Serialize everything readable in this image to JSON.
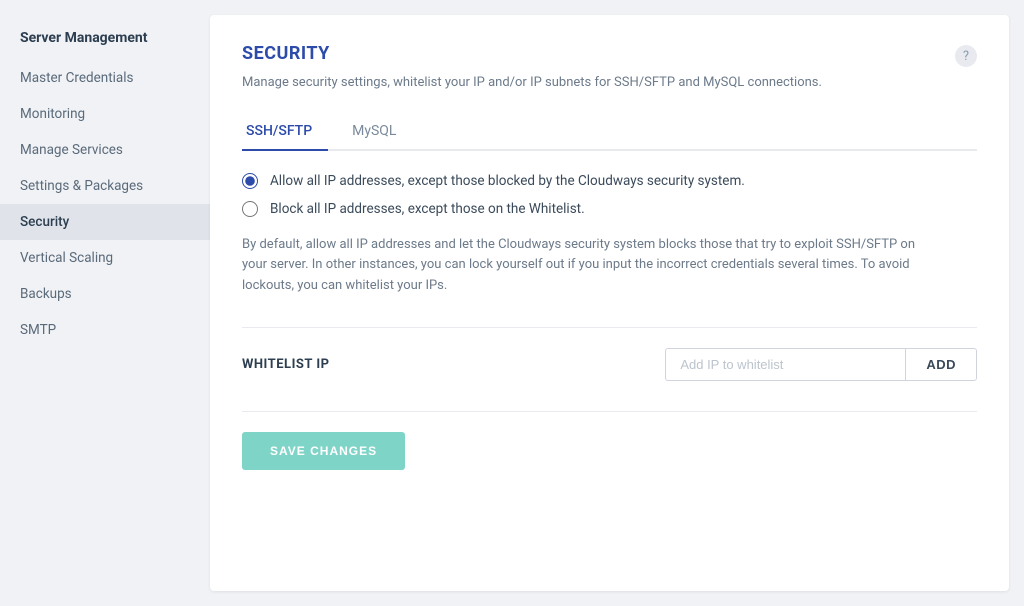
{
  "sidebar": {
    "title": "Server Management",
    "items": [
      {
        "id": "master-credentials",
        "label": "Master Credentials",
        "active": false
      },
      {
        "id": "monitoring",
        "label": "Monitoring",
        "active": false
      },
      {
        "id": "manage-services",
        "label": "Manage Services",
        "active": false
      },
      {
        "id": "settings-packages",
        "label": "Settings & Packages",
        "active": false
      },
      {
        "id": "security",
        "label": "Security",
        "active": true
      },
      {
        "id": "vertical-scaling",
        "label": "Vertical Scaling",
        "active": false
      },
      {
        "id": "backups",
        "label": "Backups",
        "active": false
      },
      {
        "id": "smtp",
        "label": "SMTP",
        "active": false
      }
    ]
  },
  "main": {
    "title": "SECURITY",
    "description": "Manage security settings, whitelist your IP and/or IP subnets for SSH/SFTP and MySQL connections.",
    "tabs": [
      {
        "id": "ssh-sftp",
        "label": "SSH/SFTP",
        "active": true
      },
      {
        "id": "mysql",
        "label": "MySQL",
        "active": false
      }
    ],
    "radio_options": [
      {
        "id": "allow-all",
        "label": "Allow all IP addresses, except those blocked by the Cloudways security system.",
        "checked": true
      },
      {
        "id": "block-all",
        "label": "Block all IP addresses, except those on the Whitelist.",
        "checked": false
      }
    ],
    "info_text": "By default, allow all IP addresses and let the Cloudways security system blocks those that try to exploit SSH/SFTP on your server. In other instances, you can lock yourself out if you input the incorrect credentials several times. To avoid lockouts, you can whitelist your IPs.",
    "whitelist": {
      "title": "WHITELIST IP",
      "input_placeholder": "Add IP to whitelist",
      "add_button_label": "ADD"
    },
    "save_button_label": "SAVE CHANGES"
  }
}
